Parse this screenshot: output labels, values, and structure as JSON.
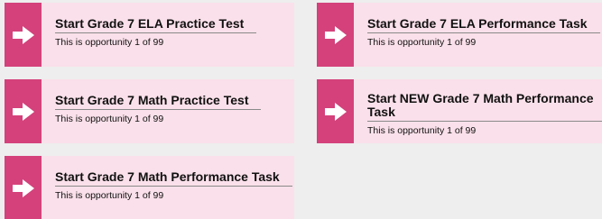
{
  "cards": [
    {
      "title": "Start Grade 7 ELA Practice Test",
      "subtitle": "This is opportunity 1 of 99",
      "icon": "arrow-right-icon"
    },
    {
      "title": "Start Grade 7 ELA Performance Task",
      "subtitle": "This is opportunity 1 of 99",
      "icon": "arrow-right-icon"
    },
    {
      "title": "Start Grade 7 Math Practice Test",
      "subtitle": "This is opportunity 1 of 99",
      "icon": "arrow-right-icon"
    },
    {
      "title": "Start NEW Grade 7 Math Performance Task",
      "subtitle": "This is opportunity 1 of 99",
      "icon": "arrow-right-icon"
    },
    {
      "title": "Start Grade 7 Math Performance Task",
      "subtitle": "This is opportunity 1 of 99",
      "icon": "arrow-right-icon"
    }
  ],
  "colors": {
    "accent": "#d4417b",
    "card_background": "#fae0ea",
    "page_background": "#eeeeee"
  }
}
